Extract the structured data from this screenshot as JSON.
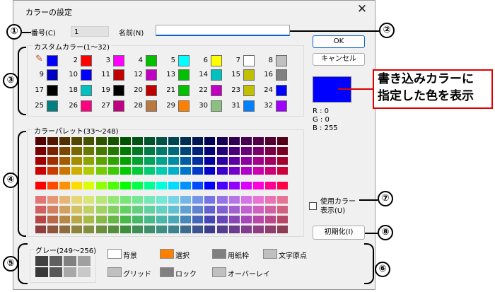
{
  "dialog": {
    "title": "カラーの設定",
    "close_glyph": "✕",
    "number_label": "番号(C)",
    "number_value": "1",
    "name_label": "名前(N)",
    "name_value": "",
    "ok_label": "OK",
    "cancel_label": "キャンセル",
    "init_label": "初期化(I)",
    "use_color_label_1": "使用カラー",
    "use_color_label_2": "表示(U)",
    "rgb": {
      "r": "R : 0",
      "g": "G : 0",
      "b": "B : 255"
    },
    "preview_color": "#0000ff"
  },
  "custom": {
    "title": "カスタムカラー(1～32)",
    "swatches": [
      {
        "n": "",
        "c": "#0000ff"
      },
      {
        "n": "2",
        "c": "#ff0000"
      },
      {
        "n": "3",
        "c": "#ff00ff"
      },
      {
        "n": "4",
        "c": "#00c000"
      },
      {
        "n": "5",
        "c": "#00ffff"
      },
      {
        "n": "6",
        "c": "#ffff00"
      },
      {
        "n": "7",
        "c": "#ffffff"
      },
      {
        "n": "8",
        "c": "#c0c0c0"
      },
      {
        "n": "9",
        "c": "#0000c0"
      },
      {
        "n": "10",
        "c": "#0000ff"
      },
      {
        "n": "11",
        "c": "#c00000"
      },
      {
        "n": "12",
        "c": "#c000c0"
      },
      {
        "n": "13",
        "c": "#00c000"
      },
      {
        "n": "14",
        "c": "#00c0c0"
      },
      {
        "n": "15",
        "c": "#c0c000"
      },
      {
        "n": "16",
        "c": "#808080"
      },
      {
        "n": "17",
        "c": "#000000"
      },
      {
        "n": "18",
        "c": "#00c0c0"
      },
      {
        "n": "19",
        "c": "#000000"
      },
      {
        "n": "20",
        "c": "#c00000"
      },
      {
        "n": "21",
        "c": "#00c000"
      },
      {
        "n": "22",
        "c": "#c000c0"
      },
      {
        "n": "23",
        "c": "#c0c000"
      },
      {
        "n": "24",
        "c": "#0000ff"
      },
      {
        "n": "25",
        "c": "#008080"
      },
      {
        "n": "26",
        "c": "#ff0080"
      },
      {
        "n": "27",
        "c": "#c00080"
      },
      {
        "n": "28",
        "c": "#b87840"
      },
      {
        "n": "29",
        "c": "#ff8000"
      },
      {
        "n": "30",
        "c": "#8cc080"
      },
      {
        "n": "31",
        "c": "#0080ff"
      },
      {
        "n": "32",
        "c": "#a000ff"
      },
      {
        "n": "",
        "c": "#c0c0c0"
      },
      {
        "n": "",
        "c": "#808080"
      }
    ]
  },
  "palette": {
    "title": "カラーパレット(33～248)"
  },
  "grey": {
    "title": "グレー(249～256)",
    "cells": [
      "#404040",
      "#606060",
      "#808080",
      "#a0a0a0",
      "#383838",
      "#585858",
      "#a8a8a8",
      "#c8c8c8"
    ]
  },
  "system": {
    "items": [
      {
        "label": "背景",
        "color": "#ffffff"
      },
      {
        "label": "選択",
        "color": "#ff8000"
      },
      {
        "label": "用紙枠",
        "color": "#808080"
      },
      {
        "label": "文字原点",
        "color": "#c0c0c0"
      },
      {
        "label": "グリッド",
        "color": "#c0c0c0"
      },
      {
        "label": "ロック",
        "color": "#808080"
      },
      {
        "label": "オーバーレイ",
        "color": "#c0c0c0"
      }
    ]
  },
  "callouts": {
    "n1": "①",
    "n2": "②",
    "n3": "③",
    "n4": "④",
    "n5": "⑤",
    "n6": "⑥",
    "n7": "⑦",
    "n8": "⑧",
    "note_line1": "書き込みカラーに",
    "note_line2": "指定した色を表示"
  }
}
